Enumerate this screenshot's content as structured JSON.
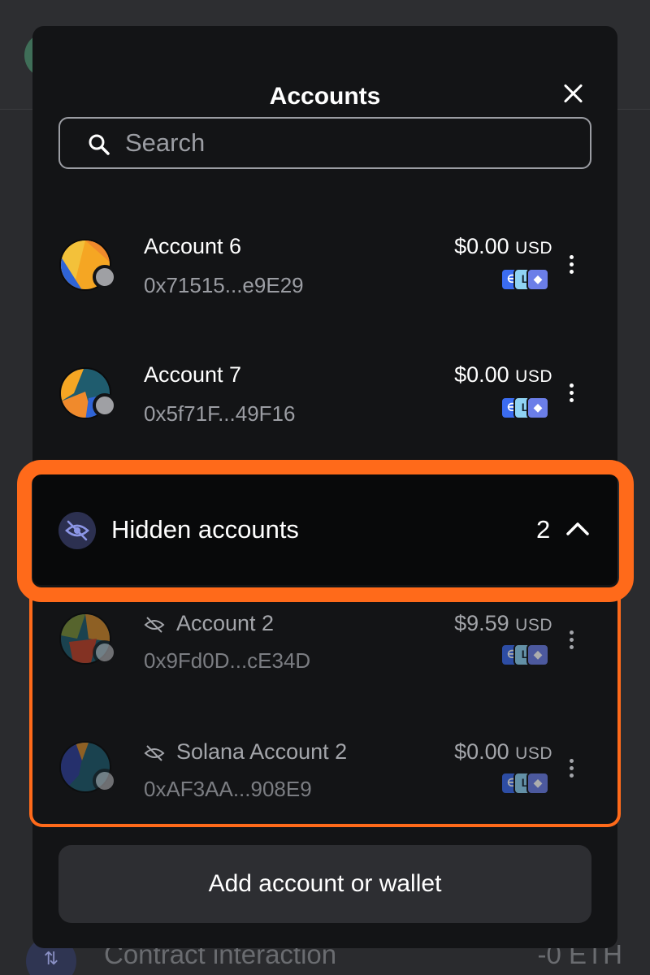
{
  "modal": {
    "title": "Accounts",
    "search_placeholder": "Search"
  },
  "accounts": [
    {
      "name": "Account 6",
      "address": "0x71515...e9E29",
      "balance": "$0.00",
      "currency": "USD"
    },
    {
      "name": "Account 7",
      "address": "0x5f71F...49F16",
      "balance": "$0.00",
      "currency": "USD"
    }
  ],
  "hidden_section": {
    "label": "Hidden accounts",
    "count": "2"
  },
  "hidden_accounts": [
    {
      "name": "Account 2",
      "address": "0x9Fd0D...cE34D",
      "balance": "$9.59",
      "currency": "USD"
    },
    {
      "name": "Solana Account 2",
      "address": "0xAF3AA...908E9",
      "balance": "$0.00",
      "currency": "USD"
    }
  ],
  "add_button_label": "Add account or wallet",
  "background": {
    "tx_label": "Contract interaction",
    "tx_amount": "-0 ETH"
  },
  "colors": {
    "highlight": "#ff6a1a",
    "modal_bg": "#131416"
  }
}
